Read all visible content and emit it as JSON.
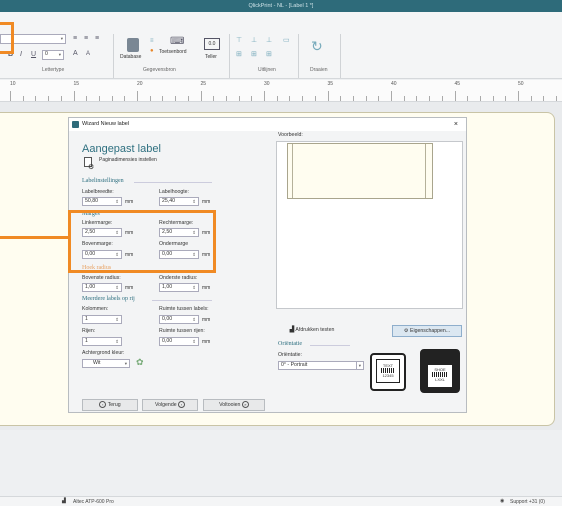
{
  "window": {
    "title": "QlickPrint - NL - [Label 1 *]"
  },
  "ribbon": {
    "font_group_label": "Lettertype",
    "datasource_group_label": "Gegevensbron",
    "align_group_label": "Uitlijnen",
    "rotate_group_label": "Draaien",
    "database_label": "Database",
    "keyboard_label": "Toetsenbord",
    "counter_label": "Teller",
    "bold": "B",
    "italic": "I",
    "underline": "U",
    "font_size": "0",
    "font_grow": "A",
    "font_shrink": "A"
  },
  "ruler": {
    "marks": [
      "10",
      "15",
      "20",
      "25",
      "30",
      "35",
      "40",
      "45",
      "50"
    ]
  },
  "dialog": {
    "title": "Wizard Nieuw label",
    "close": "×",
    "heading": "Aangepast label",
    "subheading": "Paginadimensies instellen",
    "section_label_settings": "Labelinstellingen",
    "label_width": "Labelbreedte:",
    "label_width_value": "50,80",
    "label_height": "Labelhoogte:",
    "label_height_value": "25,40",
    "section_margins": "Marges",
    "left_margin": "Linkermarge:",
    "left_margin_value": "2,50",
    "right_margin": "Rechtermarge:",
    "right_margin_value": "2,50",
    "top_margin": "Bovenmarge:",
    "top_margin_value": "0,00",
    "bottom_margin": "Ondermarge",
    "bottom_margin_value": "0,00",
    "section_corner": "Hoek radius",
    "top_radius": "Bovenste radius:",
    "top_radius_value": "1,00",
    "bottom_radius": "Onderste radius:",
    "bottom_radius_value": "1,00",
    "section_multi": "Meerdere labels op rij",
    "columns": "Kolommen:",
    "columns_value": "1",
    "gap_labels": "Ruimte tussen labels:",
    "gap_labels_value": "0,00",
    "rows": "Rijen:",
    "rows_value": "1",
    "gap_rows": "Ruimte tussen rijen:",
    "gap_rows_value": "0,00",
    "bg_color": "Achtergrond kleur:",
    "bg_color_value": "Wit",
    "unit": "mm",
    "preview_label": "Voorbeeld:",
    "test_print": "Afdrukken testen",
    "properties": "Eigenschappen...",
    "section_orientation": "Oriëntatie",
    "orientation_label": "Oriëntatie:",
    "orientation_value": "0° - Portrait",
    "printer1_text": "TEXT",
    "printer1_code": "12345",
    "printer2_text": "SHOE",
    "printer2_code": "LXXL",
    "back": "Terug",
    "next": "Volgende",
    "finish": "Voltooien"
  },
  "status": {
    "printer": "Altec ATP-600 Pro",
    "support": "Support +31 (0)"
  }
}
